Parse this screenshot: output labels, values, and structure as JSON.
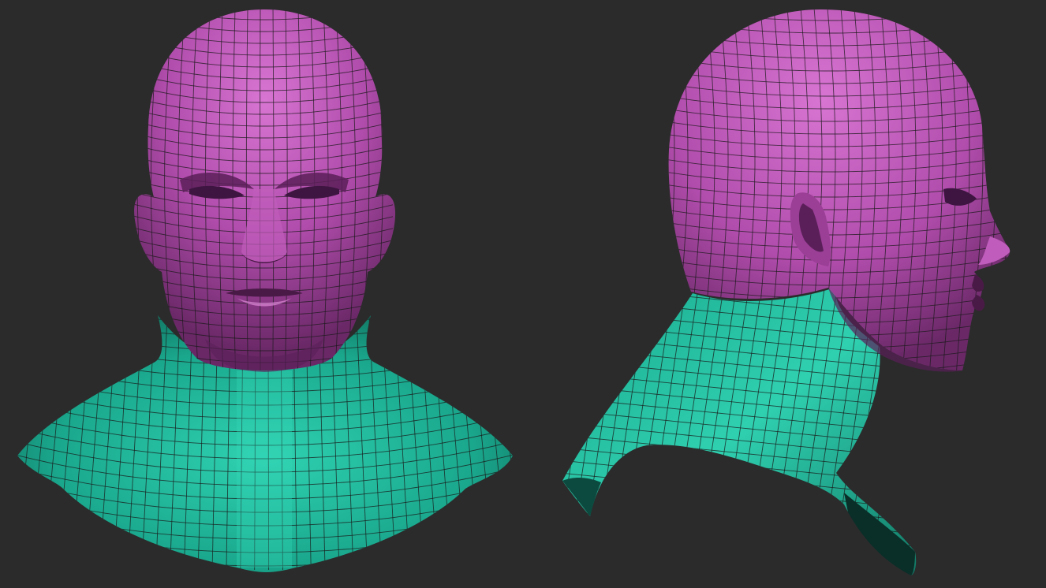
{
  "viewport": {
    "background": "#2b2b2b"
  },
  "colors": {
    "head": "#b54fb0",
    "head_highlight": "#d66fd0",
    "head_shadow": "#6e2a6b",
    "neck": "#1fae93",
    "neck_highlight": "#2fd0b0",
    "neck_shadow": "#0d5a4c",
    "wire": "#1a1a1a"
  },
  "views": [
    {
      "name": "front-view"
    },
    {
      "name": "side-view"
    }
  ]
}
